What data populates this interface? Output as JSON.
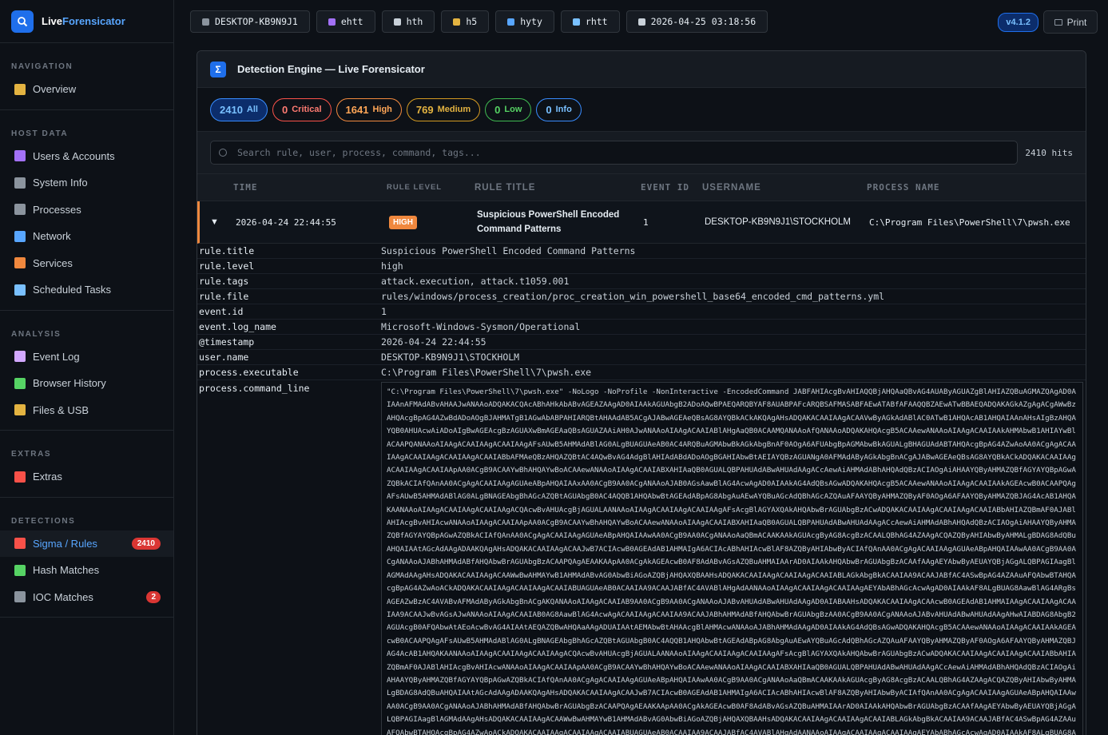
{
  "brand": {
    "part1": "Live",
    "part2": "Forensicator",
    "logo_icon": "search-icon"
  },
  "sidebar": {
    "sections": [
      {
        "title": "NAVIGATION",
        "items": [
          {
            "label": "Overview",
            "icon": "chart-icon",
            "color": "#e3b341"
          }
        ]
      },
      {
        "title": "HOST DATA",
        "items": [
          {
            "label": "Users & Accounts",
            "icon": "user-icon",
            "color": "#a371f7"
          },
          {
            "label": "System Info",
            "icon": "computer-icon",
            "color": "#8b949e"
          },
          {
            "label": "Processes",
            "icon": "gear-icon",
            "color": "#8b949e"
          },
          {
            "label": "Network",
            "icon": "globe-icon",
            "color": "#58a6ff"
          },
          {
            "label": "Services",
            "icon": "bolt-icon",
            "color": "#f0883e"
          },
          {
            "label": "Scheduled Tasks",
            "icon": "calendar-icon",
            "color": "#79c0ff"
          }
        ]
      },
      {
        "title": "ANALYSIS",
        "items": [
          {
            "label": "Event Log",
            "icon": "clipboard-icon",
            "color": "#d2a8ff"
          },
          {
            "label": "Browser History",
            "icon": "globe-icon",
            "color": "#56d364"
          },
          {
            "label": "Files & USB",
            "icon": "folder-icon",
            "color": "#e3b341"
          }
        ]
      },
      {
        "title": "EXTRAS",
        "items": [
          {
            "label": "Extras",
            "icon": "toolbox-icon",
            "color": "#f85149"
          }
        ]
      },
      {
        "title": "DETECTIONS",
        "items": [
          {
            "label": "Sigma / Rules",
            "icon": "warning-icon",
            "color": "#f85149",
            "badge": "2410",
            "active": true
          },
          {
            "label": "Hash Matches",
            "icon": "bug-icon",
            "color": "#56d364"
          },
          {
            "label": "IOC Matches",
            "icon": "link-icon",
            "color": "#8b949e",
            "badge": "2"
          }
        ]
      }
    ]
  },
  "topbar": {
    "chips": [
      {
        "text": "DESKTOP-KB9N9J1",
        "icon": "computer-icon",
        "color": "#8b949e"
      },
      {
        "text": "ehtt",
        "icon": "user-icon",
        "color": "#a371f7"
      },
      {
        "text": "hth",
        "icon": "document-icon",
        "color": "#c9d1d9"
      },
      {
        "text": "h5",
        "icon": "folder-icon",
        "color": "#e3b341"
      },
      {
        "text": "hyty",
        "icon": "globe-icon",
        "color": "#58a6ff"
      },
      {
        "text": "rhtt",
        "icon": "monitor-icon",
        "color": "#79c0ff"
      },
      {
        "text": "2026-04-25 03:18:56",
        "icon": "clock-icon",
        "color": "#c9d1d9"
      }
    ],
    "version": "v4.1.2",
    "print_label": "Print"
  },
  "panel": {
    "icon_glyph": "Σ",
    "title": "Detection Engine — Live Forensicator",
    "filters": [
      {
        "count": "2410",
        "label": "All"
      },
      {
        "count": "0",
        "label": "Critical"
      },
      {
        "count": "1641",
        "label": "High"
      },
      {
        "count": "769",
        "label": "Medium"
      },
      {
        "count": "0",
        "label": "Low"
      },
      {
        "count": "0",
        "label": "Info"
      }
    ],
    "search_placeholder": "Search rule, user, process, command, tags...",
    "hits": "2410 hits",
    "columns": [
      "TIME",
      "RULE LEVEL",
      "RULE TITLE",
      "EVENT ID",
      "USERNAME",
      "PROCESS NAME"
    ],
    "row": {
      "toggle": "▼",
      "time": "2026-04-24 22:44:55",
      "level": "HIGH",
      "title": "Suspicious PowerShell Encoded Command Patterns",
      "event_id": "1",
      "username": "DESKTOP-KB9N9J1\\STOCKHOLM",
      "process": "C:\\Program Files\\PowerShell\\7\\pwsh.exe"
    },
    "details": [
      {
        "key": "rule.title",
        "value": "Suspicious PowerShell Encoded Command Patterns"
      },
      {
        "key": "rule.level",
        "value": "high"
      },
      {
        "key": "rule.tags",
        "value": "attack.execution, attack.t1059.001"
      },
      {
        "key": "rule.file",
        "value": "rules/windows/process_creation/proc_creation_win_powershell_base64_encoded_cmd_patterns.yml"
      },
      {
        "key": "event.id",
        "value": "1"
      },
      {
        "key": "event.log_name",
        "value": "Microsoft-Windows-Sysmon/Operational"
      },
      {
        "key": "@timestamp",
        "value": "2026-04-24 22:44:55"
      },
      {
        "key": "user.name",
        "value": "DESKTOP-KB9N9J1\\STOCKHOLM"
      },
      {
        "key": "process.executable",
        "value": "C:\\Program Files\\PowerShell\\7\\pwsh.exe"
      }
    ],
    "command_line_key": "process.command_line",
    "command_line_value": "\"C:\\Program Files\\PowerShell\\7\\pwsh.exe\" -NoLogo -NoProfile -NonInteractive -EncodedCommand JABFAHIAcgBvAHIAQQBjAHQAaQBvAG4AUAByAGUAZgBlAHIAZQBuAGMAZQAgAD0AIAAnAFMAdABvAHAAJwANAAoADQAKACQAcABhAHkAbABvAGEAZAAgAD0AIAAkAGUAbgB2ADoAQwBPAEQARQBYAF8AUABPAFcARQBSAFMASABFAEwATABfAFAAQQBZAEwATwBBAEQADQAKAGkAZgAgACgAWwBzAHQAcgBpAG4AZwBdADoAOgBJAHMATgB1AGwAbABPAHIARQBtAHAAdAB5ACgAJABwAGEAeQBsAG8AYQBkACkAKQAgAHsADQAKACAAIAAgACAAVwByAGkAdABlAC0ATwB1AHQAcAB1AHQAIAAnAHsAIgBzAHQAYQB0AHUAcwAiADoAIgBwAGEAcgBzAGUAXwBmAGEAaQBsAGUAZAAiAH0AJwANAAoAIAAgACAAIABlAHgAaQB0ACAAMQANAAoAfQANAAoADQAKAHQAcgB5ACAAewANAAoAIAAgACAAIAAkAHMAbwB1AHIAYwBlACAAPQANAAoAIAAgACAAIAAgACAAIAAgAFsAUwB5AHMAdABlAG0ALgBUAGUAeAB0AC4ARQBuAGMAbwBkAGkAbgBnAF0AOgA6AFUAbgBpAGMAbwBkAGUALgBHAGUAdABTAHQAcgBpAG4AZwAoAA0ACgAgACAAIAAgACAAIAAgACAAIAAgACAAIABbAFMAeQBzAHQAZQBtAC4AQwBvAG4AdgBlAHIAdABdADoAOgBGAHIAbwBtAEIAYQBzAGUANgA0AFMAdAByAGkAbgBnACgAJABwAGEAeQBsAG8AYQBkACkADQAKACAAIAAgACAAIAAgACAAIAApAA0ACgB9ACAAYwBhAHQAYwBoACAAewANAAoAIAAgACAAIABXAHIAaQB0AGUALQBPAHUAdABwAHUAdAAgACcAewAiAHMAdABhAHQAdQBzACIAOgAiAHAAYQByAHMAZQBfAGYAYQBpAGwAZQBkACIAfQAnAA0ACgAgACAAIAAgAGUAeABpAHQAIAAxAA0ACgB9AA0ACgANAAoAJAB0AGsAawBlAG4AcwAgAD0AIAAkAG4AdQBsAGwADQAKAHQAcgB5ACAAewANAAoAIAAgACAAIAAkAGEAcwB0ACAAPQAgAFsAUwB5AHMAdABlAG0ALgBNAGEAbgBhAGcAZQBtAGUAbgB0AC4AQQB1AHQAbwBtAGEAdABpAG8AbgAuAEwAYQBuAGcAdQBhAGcAZQAuAFAAYQByAHMAZQByAF0AOgA6AFAAYQByAHMAZQBJAG4AcAB1AHQAKAANAAoAIAAgACAAIAAgACAAIAAgACQAcwBvAHUAcgBjAGUALAANAAoAIAAgACAAIAAgACAAIAAgAFsAcgBlAGYAXQAkAHQAbwBrAGUAbgBzACwADQAKACAAIAAgACAAIAAgACAAIABbAHIAZQBmAF0AJABlAHIAcgBvAHIAcwANAAoAIAAgACAAIAApAA0ACgB9ACAAYwBhAHQAYwBoACAAewANAAoAIAAgACAAIABXAHIAaQB0AGUALQBPAHUAdABwAHUAdAAgACcAewAiAHMAdABhAHQAdQBzACIAOgAiAHAAYQByAHMAZQBfAGYAYQBpAGwAZQBkACIAfQAnAA0ACgAgACAAIAAgAGUAeABpAHQAIAAwAA0ACgB9AA0ACgANAAoAaQBmACAAKAAkAGUAcgByAG8AcgBzACAALQBhAG4AZAAgACQAZQByAHIAbwByAHMALgBDAG8AdQBuAHQAIAAtAGcAdAAgADAAKQAgAHsADQAKACAAIAAgACAAJwB7ACIAcwB0AGEAdAB1AHMAIgA6ACIAcABhAHIAcwBlAF8AZQByAHIAbwByACIAfQAnAA0ACgAgACAAIAAgAGUAeABpAHQAIAAwAA0ACgB9AA0ACgANAAoAJABhAHMAdABfAHQAbwBrAGUAbgBzACAAPQAgAEAAKAApAA0ACgAkAGEAcwB0AF8AdABvAGsAZQBuAHMAIAArAD0AIAAkAHQAbwBrAGUAbgBzACAAfAAgAEYAbwByAEUAYQBjAGgALQBPAGIAagBlAGMAdAAgAHsADQAKACAAIAAgACAAWwBwAHMAYwB1AHMAdABvAG0AbwBiAGoAZQBjAHQAXQBAAHsADQAKACAAIAAgACAAIAAgACAAIABLAGkAbgBkACAAIAA9ACAAJABfAC4ASwBpAG4AZAAuAFQAbwBTAHQAcgBpAG4AZwAoACkADQAKACAAIAAgACAAIAAgACAAIABUAGUAeAB0ACAAIAA9ACAAJABfAC4AVABlAHgAdAANAAoAIAAgACAAIAAgACAAIAAgAEYAbABhAGcAcwAgAD0AIAAkAF8ALgBUAG8AawBlAG4ARgBsAGEAZwBzAC4AVABvAFMAdAByAGkAbgBnACgAKQANAAoAIAAgACAAIAB9AA0ACgB9AA0ACgANAAoAJABvAHUAdABwAHUAdAAgAD0AIABAAHsADQAKACAAIAAgACAAcwB0AGEAdAB1AHMAIAAgACAAIAAgACAAIAA9ACAAJwBvAGsAJwANAAoAIAAgACAAIAB0AG8AawBlAG4AcwAgACAAIAAgACAAIAA9ACAAJABhAHMAdABfAHQAbwBrAGUAbgBzAA0ACgB9AA0ACgANAAoAJABvAHUAdABwAHUAdAAgAHwAIABDAG8AbgB2AGUAcgB0AFQAbwAtAEoAcwBvAG4AIAAtAEQAZQBwAHQAaAAgADUAIAAtAEMAbwBtAHAAcgBlAHMAcwANAAoAJABhAHMAdAAgAD0AIAAkAG4AdQBsAGwADQAKAHQAcgB5ACAAewANAAoAIAAgACAAIAAkAGEAcwB0ACAAPQAgAFsAUwB5AHMAdABlAG0ALgBNAGEAbgBhAGcAZQBtAGUAbgB0AC4AQQB1AHQAbwBtAGEAdABpAG8AbgAuAEwAYQBuAGcAdQBhAGcAZQAuAFAAYQByAHMAZQByAF0AOgA6AFAAYQByAHMAZQBJAG4AcAB1AHQAKAANAAoAIAAgACAAIAAgACAAIAAgACQAcwBvAHUAcgBjAGUALAANAAoAIAAgACAAIAAgACAAIAAgAFsAcgBlAGYAXQAkAHQAbwBrAGUAbgBzACwADQAKACAAIAAgACAAIAAgACAAIABbAHIAZQBmAF0AJABlAHIAcgBvAHIAcwANAAoAIAAgACAAIAApAA0ACgB9ACAAYwBhAHQAYwBoACAAewANAAoAIAAgACAAIABXAHIAaQB0AGUALQBPAHUAdABwAHUAdAAgACcAewAiAHMAdABhAHQAdQBzACIAOgAiAHAAYQByAHMAZQBfAGYAYQBpAGwAZQBkACIAfQAnAA0ACgAgACAAIAAgAGUAeABpAHQAIAAwAA0ACgB9AA0ACgANAAoAaQBmACAAKAAkAGUAcgByAG8AcgBzACAALQBhAG4AZAAgACQAZQByAHIAbwByAHMALgBDAG8AdQBuAHQAIAAtAGcAdAAgADAAKQAgAHsADQAKACAAIAAgACAAJwB7ACIAcwB0AGEAdAB1AHMAIgA6ACIAcABhAHIAcwBlAF8AZQByAHIAbwByACIAfQAnAA0ACgAgACAAIAAgAGUAeABpAHQAIAAwAA0ACgB9AA0ACgANAAoAJABhAHMAdABfAHQAbwBrAGUAbgBzACAAPQAgAEAAKAApAA0ACgAkAGEAcwB0AF8AdABvAGsAZQBuAHMAIAArAD0AIAAkAHQAbwBrAGUAbgBzACAAfAAgAEYAbwByAEUAYQBjAGgALQBPAGIAagBlAGMAdAAgAHsADQAKACAAIAAgACAAWwBwAHMAYwB1AHMAdABvAG0AbwBiAGoAZQBjAHQAXQBAAHsADQAKACAAIAAgACAAIAAgACAAIABLAGkAbgBkACAAIAA9ACAAJABfAC4ASwBpAG4AZAAuAFQAbwBTAHQAcgBpAG4AZwAoACkADQAKACAAIAAgACAAIAAgACAAIABUAGUAeAB0ACAAIAA9ACAAJABfAC4AVABlAHgAdAANAAoAIAAgACAAIAAgACAAIAAgAEYAbABhAGcAcwAgAD0AIAAkAF8ALgBUAG8AawBlAG4ARgBsAGEAZwBzAC4AVABvAFMAdAByAGkAbgBnACgAKQANAAoAIAAgACAAIAB9AA0ACgB9AA0ACgANAAoA"
  }
}
